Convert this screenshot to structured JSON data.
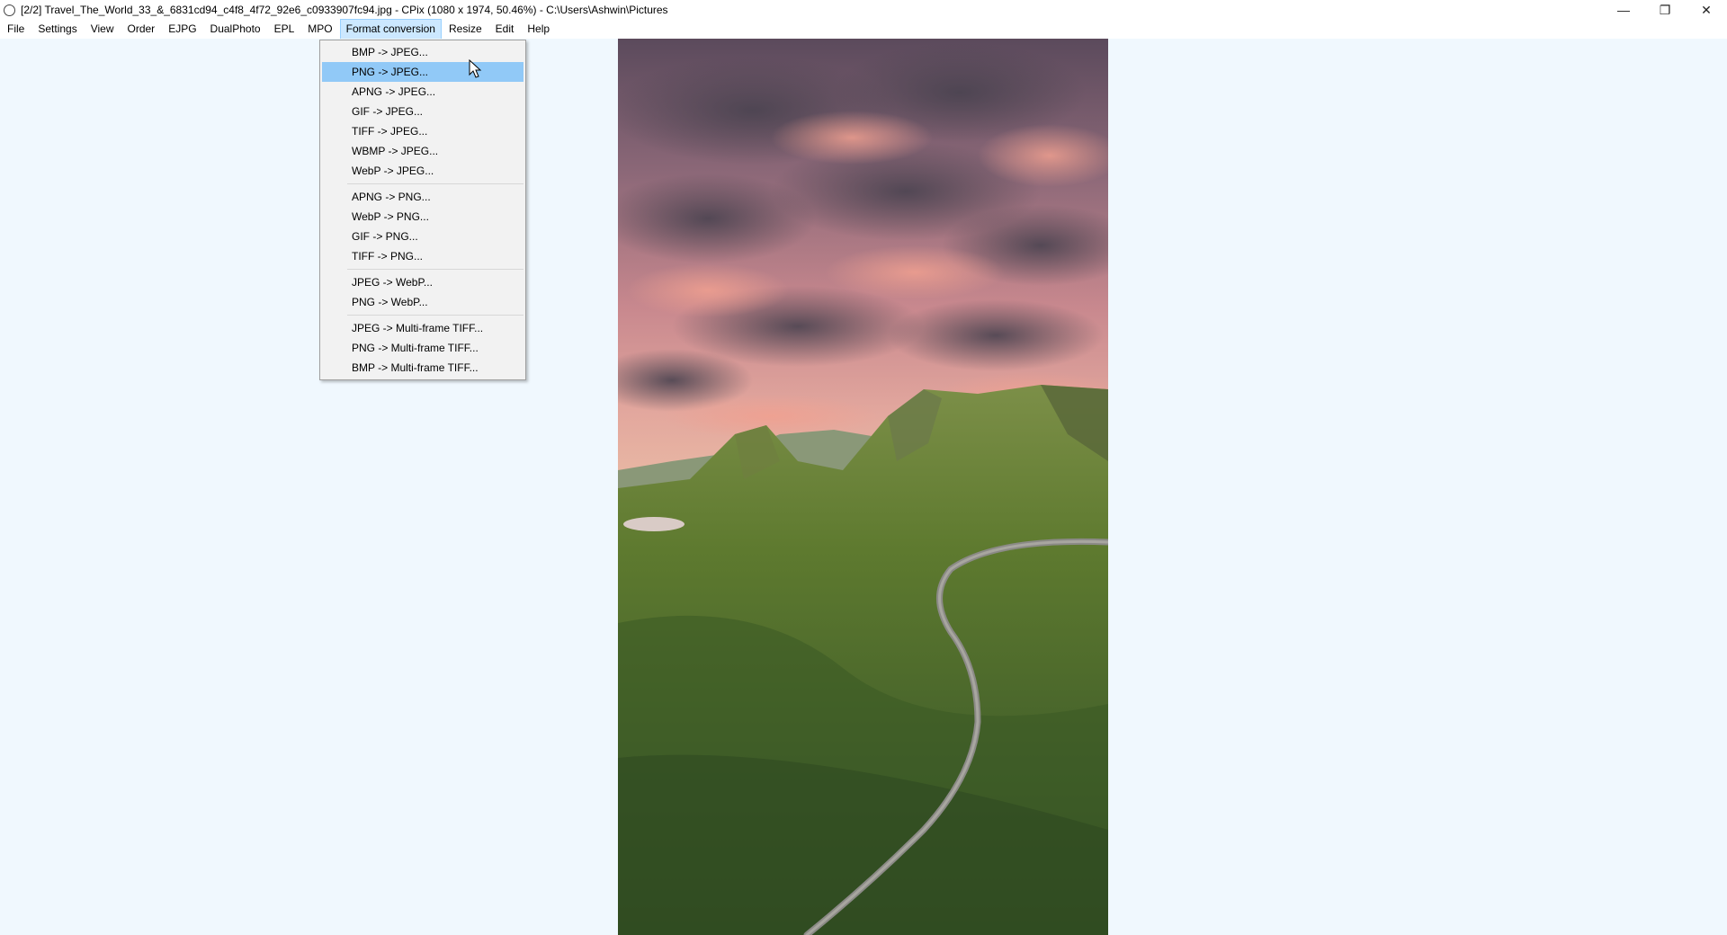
{
  "window": {
    "title": "[2/2] Travel_The_World_33_&_6831cd94_c4f8_4f72_92e6_c0933907fc94.jpg - CPix (1080 x 1974, 50.46%) - C:\\Users\\Ashwin\\Pictures",
    "minimize_glyph": "—",
    "restore_glyph": "❐",
    "close_glyph": "✕"
  },
  "menubar": {
    "items": [
      "File",
      "Settings",
      "View",
      "Order",
      "EJPG",
      "DualPhoto",
      "EPL",
      "MPO",
      "Format conversion",
      "Resize",
      "Edit",
      "Help"
    ],
    "active": "Format conversion"
  },
  "format_menu": {
    "groups": [
      [
        "BMP -> JPEG...",
        "PNG -> JPEG...",
        "APNG -> JPEG...",
        "GIF -> JPEG...",
        "TIFF -> JPEG...",
        "WBMP -> JPEG...",
        "WebP -> JPEG..."
      ],
      [
        "APNG -> PNG...",
        "WebP -> PNG...",
        "GIF -> PNG...",
        "TIFF -> PNG..."
      ],
      [
        "JPEG -> WebP...",
        "PNG -> WebP..."
      ],
      [
        "JPEG -> Multi-frame TIFF...",
        "PNG -> Multi-frame TIFF...",
        "BMP -> Multi-frame TIFF..."
      ]
    ],
    "hovered": "PNG -> JPEG..."
  },
  "colors": {
    "background": "#f0f8fe",
    "menu_active": "#cce8ff",
    "menu_hover": "#91c9f7"
  }
}
